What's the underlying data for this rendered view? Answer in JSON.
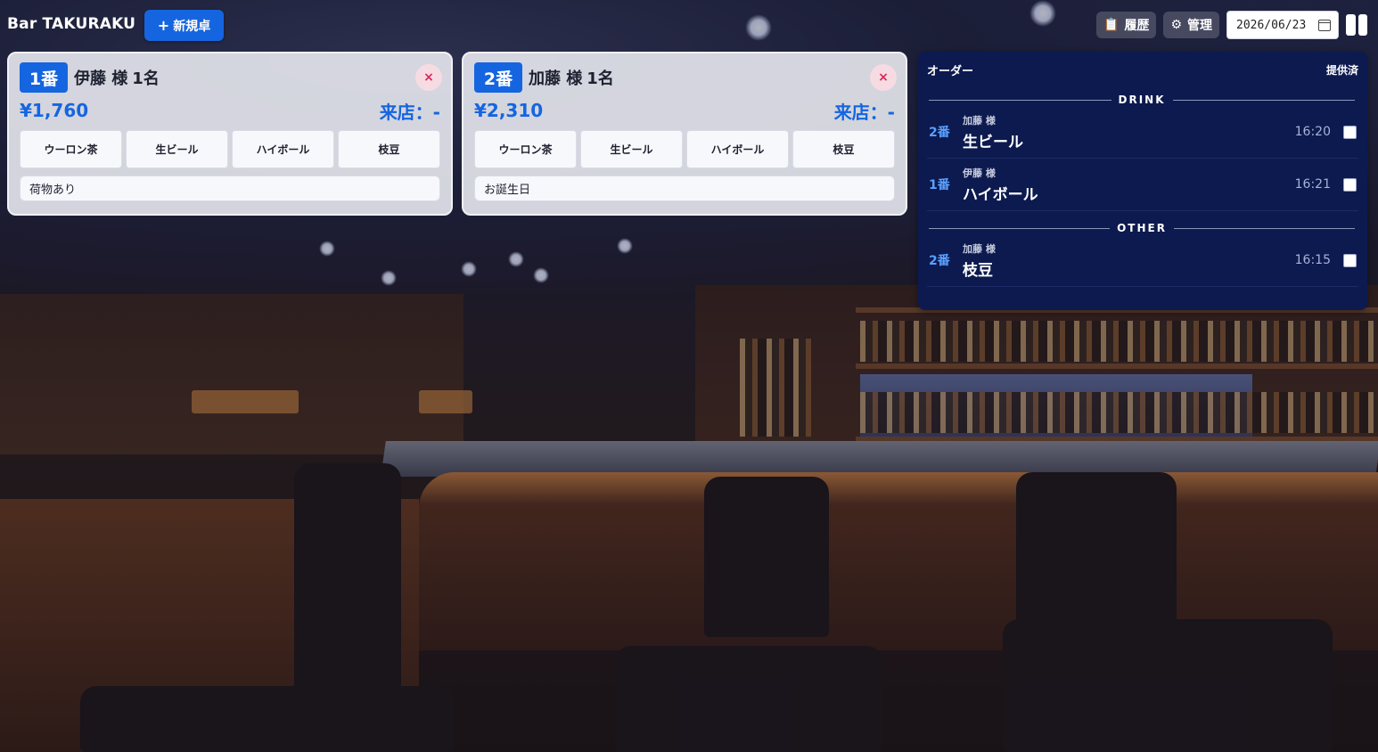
{
  "header": {
    "app_title": "Bar TAKURAKU",
    "new_table_label": "新規卓",
    "history_label": "履歴",
    "admin_label": "管理",
    "date_value": "2026/06/23"
  },
  "icons": {
    "plus": "plus-icon",
    "history": "clipboard-icon",
    "admin": "gear-icon",
    "calendar": "calendar-icon",
    "layout": "columns-icon",
    "close": "close-icon"
  },
  "colors": {
    "accent": "#1565e0",
    "panel": "#0c1a4f",
    "close": "#d7265b"
  },
  "tables": [
    {
      "number": "1番",
      "guest": "伊藤 様",
      "count": "1名",
      "total": "¥1,760",
      "arrival": "来店：-",
      "close": "×",
      "items": [
        "ウーロン茶",
        "生ビール",
        "ハイボール",
        "枝豆"
      ],
      "memo": "荷物あり"
    },
    {
      "number": "2番",
      "guest": "加藤 様",
      "count": "1名",
      "total": "¥2,310",
      "arrival": "来店：-",
      "close": "×",
      "items": [
        "ウーロン茶",
        "生ビール",
        "ハイボール",
        "枝豆"
      ],
      "memo": "お誕生日"
    }
  ],
  "orders": {
    "title": "オーダー",
    "served_label": "提供済",
    "sections": [
      {
        "name": "DRINK",
        "rows": [
          {
            "table": "2番",
            "guest": "加藤 様",
            "item": "生ビール",
            "time": "16:20",
            "served": false
          },
          {
            "table": "1番",
            "guest": "伊藤 様",
            "item": "ハイボール",
            "time": "16:21",
            "served": false
          }
        ]
      },
      {
        "name": "OTHER",
        "rows": [
          {
            "table": "2番",
            "guest": "加藤 様",
            "item": "枝豆",
            "time": "16:15",
            "served": false
          }
        ]
      }
    ]
  }
}
